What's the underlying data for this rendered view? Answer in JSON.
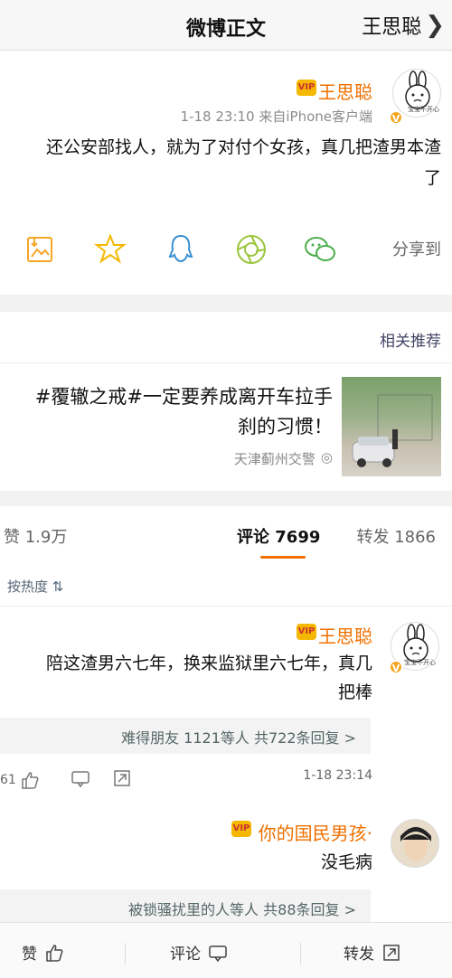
{
  "navbar": {
    "title": "微博正文",
    "back_label": "王思聪"
  },
  "post": {
    "author": "王思聪",
    "vip_mark": "V",
    "crown_text": "VIP",
    "avatar_caption": "宝宝不开心",
    "meta": "1-18 23:10  来自iPhone客户端",
    "text_line1": "还公安部找人，就为了对付个女孩，真几把渣男本渣",
    "text_line2": "了"
  },
  "share": {
    "label": "分享到",
    "icons": [
      "wechat-icon",
      "moments-icon",
      "qq-icon",
      "qzone-icon",
      "save-image-icon"
    ]
  },
  "related": {
    "header": "相关推荐",
    "title_line1": "#覆辙之戒#一定要养成离开车拉手",
    "title_line2": "刹的习惯！",
    "source_mark": "◎",
    "source": "天津蓟州交警"
  },
  "comments": {
    "tabs": {
      "repost": "转发 1866",
      "comment": "评论 7699",
      "like": "赞 1.9万"
    },
    "sort_label": "按热度 ⇅",
    "items": [
      {
        "author": "王思聪",
        "crown_text": "VIP",
        "vip_mark": "V",
        "avatar_caption": "宝宝不开心",
        "text_line1": "陪这渣男六七年，换来监狱里六七年，真几",
        "text_line2": "把棒",
        "replies": "难得朋友 1121等人  共722条回复 >",
        "time": "1-18 23:14",
        "likes": "61"
      },
      {
        "author": "你的国民男孩·",
        "crown_text": "VIP",
        "text_line1": "没毛病",
        "replies": "被锁骚扰里的人等人  共88条回复 >"
      }
    ]
  },
  "bottom_bar": {
    "repost": "转发",
    "comment": "评论",
    "like": "赞"
  },
  "colors": {
    "accent": "#f07000",
    "crown": "#f5b800",
    "vip": "#f5a623"
  }
}
